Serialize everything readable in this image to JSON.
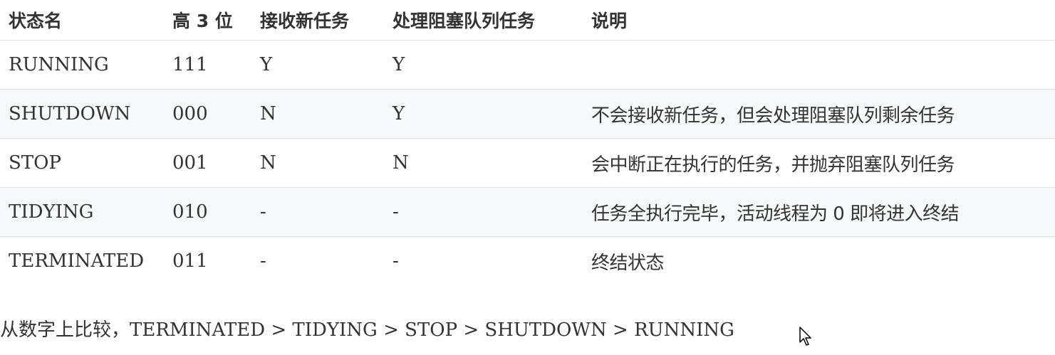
{
  "table": {
    "headers": [
      "状态名",
      "高 3 位",
      "接收新任务",
      "处理阻塞队列任务",
      "说明"
    ],
    "rows": [
      {
        "name": "RUNNING",
        "bits": "111",
        "accept": "Y",
        "process": "Y",
        "desc": ""
      },
      {
        "name": "SHUTDOWN",
        "bits": "000",
        "accept": "N",
        "process": "Y",
        "desc": "不会接收新任务，但会处理阻塞队列剩余任务"
      },
      {
        "name": "STOP",
        "bits": "001",
        "accept": "N",
        "process": "N",
        "desc": "会中断正在执行的任务，并抛弃阻塞队列任务"
      },
      {
        "name": "TIDYING",
        "bits": "010",
        "accept": "-",
        "process": "-",
        "desc": "任务全执行完毕，活动线程为 0 即将进入终结"
      },
      {
        "name": "TERMINATED",
        "bits": "011",
        "accept": "-",
        "process": "-",
        "desc": "终结状态"
      }
    ]
  },
  "comparison": {
    "prefix": "从数字上比较，",
    "text": "TERMINATED > TIDYING > STOP > SHUTDOWN > RUNNING"
  },
  "cursor": {
    "icon": "mouse-pointer-icon"
  }
}
